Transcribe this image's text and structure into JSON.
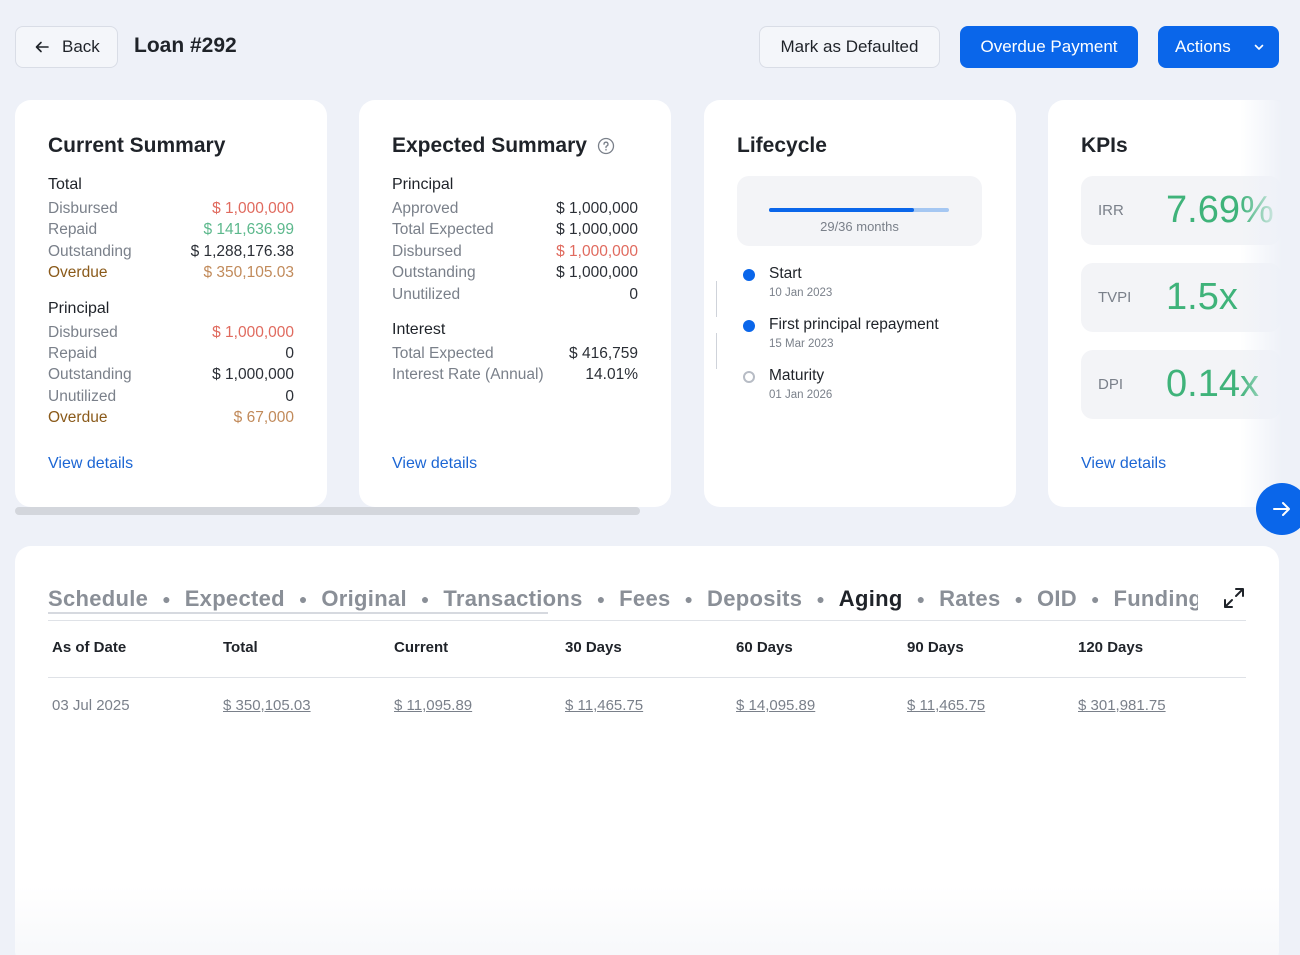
{
  "header": {
    "back_label": "Back",
    "title": "Loan #292",
    "mark_defaulted_label": "Mark as Defaulted",
    "overdue_payment_label": "Overdue Payment",
    "actions_label": "Actions"
  },
  "current_summary": {
    "title": "Current Summary",
    "total_title": "Total",
    "total_rows": [
      {
        "label": "Disbursed",
        "value": "$ 1,000,000"
      },
      {
        "label": "Repaid",
        "value": "$ 141,636.99"
      },
      {
        "label": "Outstanding",
        "value": "$ 1,288,176.38"
      },
      {
        "label": "Overdue",
        "value": "$ 350,105.03"
      }
    ],
    "principal_title": "Principal",
    "principal_rows": [
      {
        "label": "Disbursed",
        "value": "$ 1,000,000"
      },
      {
        "label": "Repaid",
        "value": "0"
      },
      {
        "label": "Outstanding",
        "value": "$ 1,000,000"
      },
      {
        "label": "Unutilized",
        "value": "0"
      },
      {
        "label": "Overdue",
        "value": "$ 67,000"
      }
    ],
    "view_details": "View details"
  },
  "expected_summary": {
    "title": "Expected Summary",
    "principal_title": "Principal",
    "principal_rows": [
      {
        "label": "Approved",
        "value": "$ 1,000,000"
      },
      {
        "label": "Total Expected",
        "value": "$ 1,000,000"
      },
      {
        "label": "Disbursed",
        "value": "$ 1,000,000"
      },
      {
        "label": "Outstanding",
        "value": "$ 1,000,000"
      },
      {
        "label": "Unutilized",
        "value": "0"
      }
    ],
    "interest_title": "Interest",
    "interest_rows": [
      {
        "label": "Total Expected",
        "value": "$ 416,759"
      },
      {
        "label": "Interest Rate (Annual)",
        "value": "14.01%"
      }
    ],
    "view_details": "View details"
  },
  "lifecycle": {
    "title": "Lifecycle",
    "progress_fraction": 0.8056,
    "progress_label": "29/36 months",
    "events": [
      {
        "title": "Start",
        "date": "10 Jan 2023",
        "done": true
      },
      {
        "title": "First principal repayment",
        "date": "15 Mar 2023",
        "done": true
      },
      {
        "title": "Maturity",
        "date": "01 Jan 2026",
        "done": false
      }
    ]
  },
  "kpis": {
    "title": "KPIs",
    "items": [
      {
        "label": "IRR",
        "value": "7.69%"
      },
      {
        "label": "TVPI",
        "value": "1.5x"
      },
      {
        "label": "DPI",
        "value": "0.14x"
      }
    ],
    "view_details": "View details"
  },
  "tabs": [
    {
      "label": "Schedule",
      "active": false
    },
    {
      "label": "Expected",
      "active": false
    },
    {
      "label": "Original",
      "active": false
    },
    {
      "label": "Transactions",
      "active": false
    },
    {
      "label": "Fees",
      "active": false
    },
    {
      "label": "Deposits",
      "active": false
    },
    {
      "label": "Aging",
      "active": true
    },
    {
      "label": "Rates",
      "active": false
    },
    {
      "label": "OID",
      "active": false
    },
    {
      "label": "Funding Sc",
      "active": false
    }
  ],
  "table": {
    "columns": [
      "As of Date",
      "Total",
      "Current",
      "30 Days",
      "60 Days",
      "90 Days",
      "120 Days"
    ],
    "rows": [
      [
        "03 Jul 2025",
        "$ 350,105.03",
        "$ 11,095.89",
        "$ 11,465.75",
        "$ 14,095.89",
        "$ 11,465.75",
        "$ 301,981.75"
      ]
    ]
  },
  "colors": {
    "primary": "#0a66ea",
    "negative": "#e06a5e",
    "positive": "#5cb88c",
    "overdue_value": "#c18a5a",
    "kpi_value": "#3fb37a"
  }
}
